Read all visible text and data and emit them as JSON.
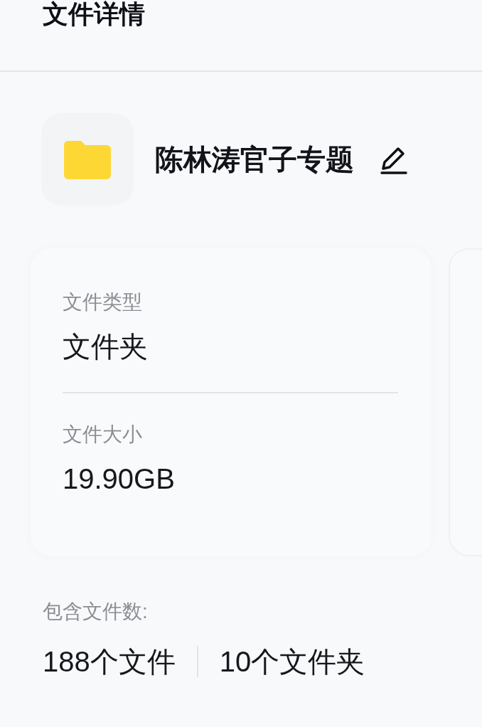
{
  "header": {
    "title": "文件详情"
  },
  "folder": {
    "name": "陈林涛官子专题"
  },
  "info_card": {
    "rows": [
      {
        "label": "文件类型",
        "value": "文件夹"
      },
      {
        "label": "文件大小",
        "value": "19.90GB"
      }
    ]
  },
  "contents": {
    "label": "包含文件数:",
    "counts": [
      "188个文件",
      "10个文件夹"
    ]
  }
}
